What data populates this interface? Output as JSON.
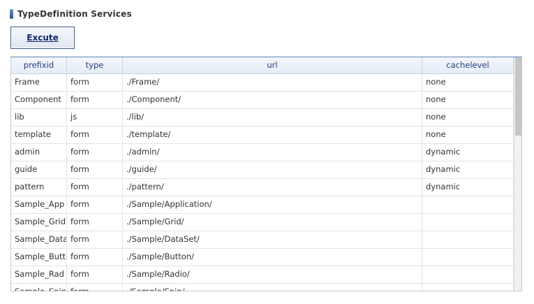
{
  "title": {
    "text": "TypeDefinition Services"
  },
  "toolbar": {
    "execute_label": "Excute"
  },
  "grid": {
    "columns": [
      "prefixid",
      "type",
      "url",
      "cachelevel"
    ],
    "rows": [
      [
        "Frame",
        "form",
        "./Frame/",
        "none"
      ],
      [
        "Component",
        "form",
        "./Component/",
        "none"
      ],
      [
        "lib",
        "js",
        "./lib/",
        "none"
      ],
      [
        "template",
        "form",
        "./template/",
        "none"
      ],
      [
        "admin",
        "form",
        "./admin/",
        "dynamic"
      ],
      [
        "guide",
        "form",
        "./guide/",
        "dynamic"
      ],
      [
        "pattern",
        "form",
        "./pattern/",
        "dynamic"
      ],
      [
        "Sample_App",
        "form",
        "./Sample/Application/",
        ""
      ],
      [
        "Sample_Grid",
        "form",
        "./Sample/Grid/",
        ""
      ],
      [
        "Sample_Data",
        "form",
        "./Sample/DataSet/",
        ""
      ],
      [
        "Sample_Butt",
        "form",
        "./Sample/Button/",
        ""
      ],
      [
        "Sample_Rad",
        "form",
        "./Sample/Radio/",
        ""
      ],
      [
        "Sample_Spin",
        "form",
        "./Sample/Spin/",
        ""
      ]
    ]
  },
  "colors": {
    "accent": "#2e4f9e",
    "header_text": "#24407a",
    "button_border": "#38598c"
  }
}
